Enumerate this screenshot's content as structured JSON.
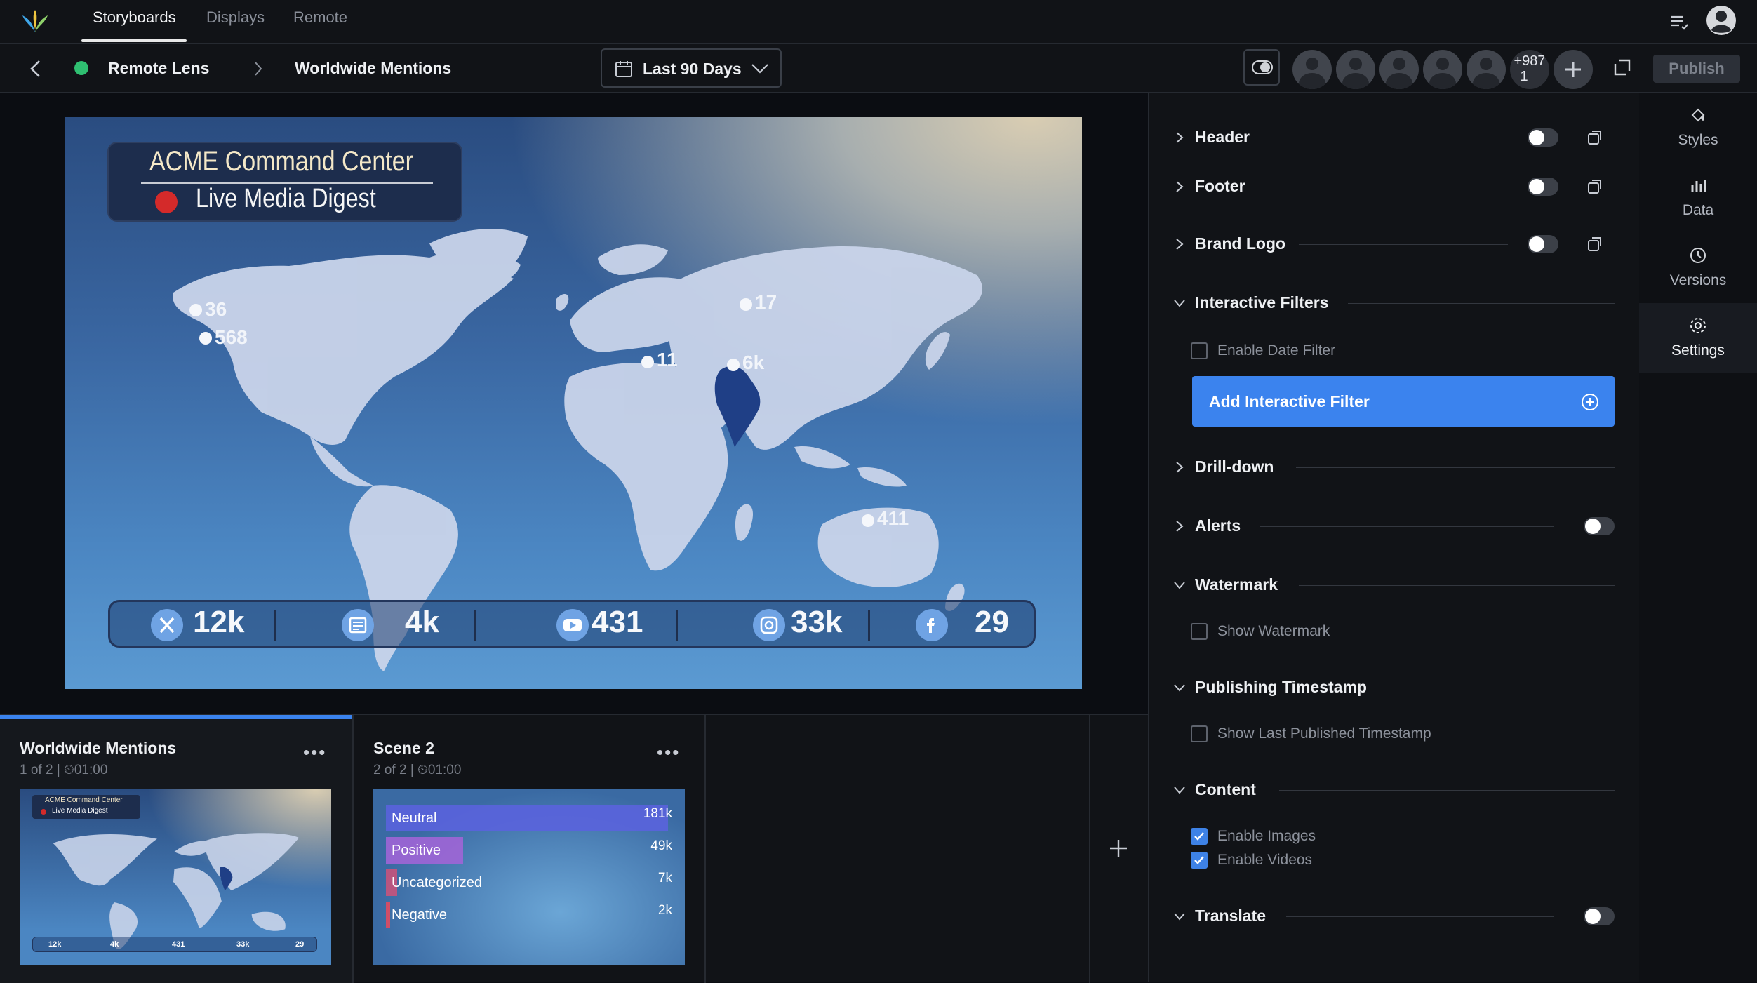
{
  "topbar": {
    "tabs": [
      {
        "label": "Storyboards"
      },
      {
        "label": "Displays"
      },
      {
        "label": "Remote"
      }
    ]
  },
  "subbar": {
    "breadcrumb_1": "Remote Lens",
    "breadcrumb_2": "Worldwide Mentions",
    "date_range": "Last 90 Days",
    "extra_users_line1": "+987",
    "extra_users_line2": "1",
    "publish_label": "Publish"
  },
  "slide": {
    "title": "ACME Command Center",
    "subtitle": "Live Media Digest",
    "map_labels": [
      "36",
      "568",
      "17",
      "11",
      "6k",
      "411"
    ],
    "stats": [
      {
        "icon": "x-icon",
        "value": "12k"
      },
      {
        "icon": "news-icon",
        "value": "4k"
      },
      {
        "icon": "youtube-icon",
        "value": "431"
      },
      {
        "icon": "instagram-icon",
        "value": "33k"
      },
      {
        "icon": "facebook-icon",
        "value": "29"
      }
    ]
  },
  "scenes": [
    {
      "title": "Worldwide Mentions",
      "meta": "1 of 2  |  ⏲01:00",
      "thumb_title": "ACME Command Center",
      "thumb_subtitle": "Live Media Digest",
      "thumb_stats": [
        "12k",
        "4k",
        "431",
        "33k",
        "29"
      ]
    },
    {
      "title": "Scene 2",
      "meta": "2 of 2  |  ⏲01:00",
      "bars": [
        {
          "label": "Neutral",
          "value": "181k",
          "fraction": 0.99,
          "color": "#5a63dd"
        },
        {
          "label": "Positive",
          "value": "49k",
          "fraction": 0.27,
          "color": "#a065d6"
        },
        {
          "label": "Uncategorized",
          "value": "7k",
          "fraction": 0.04,
          "color": "#c6537c"
        },
        {
          "label": "Negative",
          "value": "2k",
          "fraction": 0.01,
          "color": "#e04a62"
        }
      ]
    }
  ],
  "settings": {
    "header": "Header",
    "footer": "Footer",
    "brand_logo": "Brand Logo",
    "interactive_filters": "Interactive Filters",
    "enable_date_filter": "Enable Date Filter",
    "add_interactive_filter": "Add Interactive Filter",
    "drill_down": "Drill-down",
    "alerts": "Alerts",
    "watermark": "Watermark",
    "show_watermark": "Show Watermark",
    "publishing_timestamp": "Publishing Timestamp",
    "show_last_published": "Show Last Published Timestamp",
    "content": "Content",
    "enable_images": "Enable Images",
    "enable_videos": "Enable Videos",
    "translate": "Translate"
  },
  "sidetabs": [
    {
      "label": "Styles"
    },
    {
      "label": "Data"
    },
    {
      "label": "Versions"
    },
    {
      "label": "Settings"
    }
  ],
  "colors": {
    "accent": "#3b83ee",
    "status_green": "#2fbf71",
    "live_red": "#d42a2a"
  }
}
